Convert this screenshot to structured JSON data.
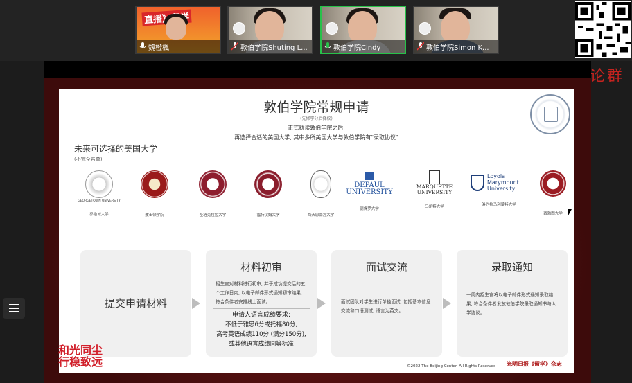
{
  "participants": [
    {
      "name": "魏橙楓",
      "poster_text": "直播》留学"
    },
    {
      "name": "敦伯学院Shuting L..."
    },
    {
      "name": "敦伯学院Cindy"
    },
    {
      "name": "敦伯学院Simon K..."
    }
  ],
  "side_text": "讨论群",
  "slide": {
    "title": "敦伯学院常规申请",
    "note": "(先修学分后择校)",
    "sub1": "正式就读敦伯学院之后,",
    "sub2": "再选择合适的美国大学, 其中多所美国大学与敦伯学院有\"录取协议\"",
    "future_title": "未来可选择的美国大学",
    "future_sub": "(不完全名单)",
    "universities": [
      {
        "caption": "乔治城大学",
        "mark": "GEORGETOWN UNIVERSITY"
      },
      {
        "caption": "波士顿学院",
        "mark": ""
      },
      {
        "caption": "圣塔克拉拉大学",
        "mark": ""
      },
      {
        "caption": "福特汉姆大学",
        "mark": ""
      },
      {
        "caption": "西沃恩南方大学",
        "mark": ""
      },
      {
        "caption": "德保罗大学",
        "mark": "DEPAUL UNIVERSITY"
      },
      {
        "caption": "马凯特大学",
        "mark": "MARQUETTE UNIVERSITY"
      },
      {
        "caption": "洛约拉马利蒙特大学",
        "mark": "Loyola Marymount University"
      },
      {
        "caption": "西雅图大学",
        "mark": ""
      }
    ],
    "steps": [
      {
        "title": "提交申请材料",
        "body": ""
      },
      {
        "title": "材料初审",
        "body": "招生官对材料进行初审, 并于成功提交后的五个工作日内, 以电子邮件形式通知初审结果, 符合条件者安排线上面试。"
      },
      {
        "title": "面试交流",
        "body": "面试团队对学生进行单独面试, 包括基本信息交流和口语测试, 语言为英文。"
      },
      {
        "title": "录取通知",
        "body": "一周内招生官将以电子邮件形式通知录取结果, 符合条件者发放敦伯学院录取通知书与入学协议。"
      }
    ],
    "lang_title": "申请人语言成绩要求:",
    "lang_lines": [
      "不低于雅思6分或托福80分,",
      "高考英语成绩110分 (满分150分),",
      "或其他语言成绩同等标准"
    ],
    "copyright": "©2022 The Beijing Center. All Rights Reserved",
    "magazine": "光明日报《留学》杂志"
  },
  "brand": {
    "line1": "和光同尘",
    "line2": "行稳致远"
  },
  "colors": {
    "active_border": "#28c14a",
    "accent_red": "#c5231f"
  }
}
